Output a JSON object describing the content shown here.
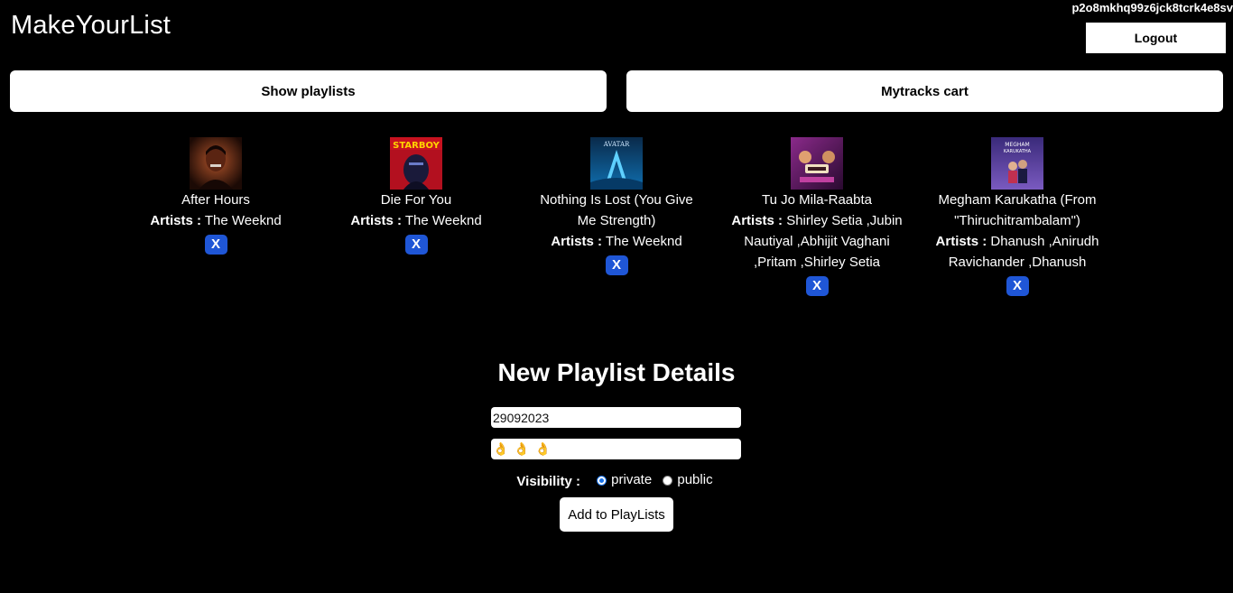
{
  "header": {
    "app_title": "MakeYourList",
    "user_id": "p2o8mkhq99z6jck8tcrk4e8sv",
    "logout_label": "Logout"
  },
  "nav": {
    "show_playlists_label": "Show playlists",
    "cart_label": "Mytracks cart"
  },
  "tracks": [
    {
      "title": "After Hours",
      "artists_label": "Artists :",
      "artists": " The Weeknd",
      "remove_label": "X",
      "cover_icon": "album-cover-after-hours"
    },
    {
      "title": "Die For You",
      "artists_label": "Artists :",
      "artists": " The Weeknd",
      "remove_label": "X",
      "cover_icon": "album-cover-starboy"
    },
    {
      "title": "Nothing Is Lost (You Give Me Strength)",
      "artists_label": "Artists :",
      "artists": " The Weeknd",
      "remove_label": "X",
      "cover_icon": "album-cover-avatar"
    },
    {
      "title": "Tu Jo Mila-Raabta",
      "artists_label": "Artists :",
      "artists": " Shirley Setia ,Jubin Nautiyal ,Abhijit Vaghani ,Pritam ,Shirley Setia",
      "remove_label": "X",
      "cover_icon": "album-cover-raabta"
    },
    {
      "title": "Megham Karukatha (From \"Thiruchitrambalam\")",
      "artists_label": "Artists :",
      "artists": " Dhanush ,Anirudh Ravichander ,Dhanush",
      "remove_label": "X",
      "cover_icon": "album-cover-megham"
    }
  ],
  "form": {
    "title": "New Playlist Details",
    "name_value": "29092023",
    "description_value": "👌👌👌",
    "visibility_label": "Visibility :",
    "visibility_options": [
      "private",
      "public"
    ],
    "visibility_selected": "private",
    "submit_label": "Add to PlayLists"
  },
  "colors": {
    "background": "#000000",
    "remove_button": "#1f56d6",
    "radio_accent": "#1a73e8"
  }
}
